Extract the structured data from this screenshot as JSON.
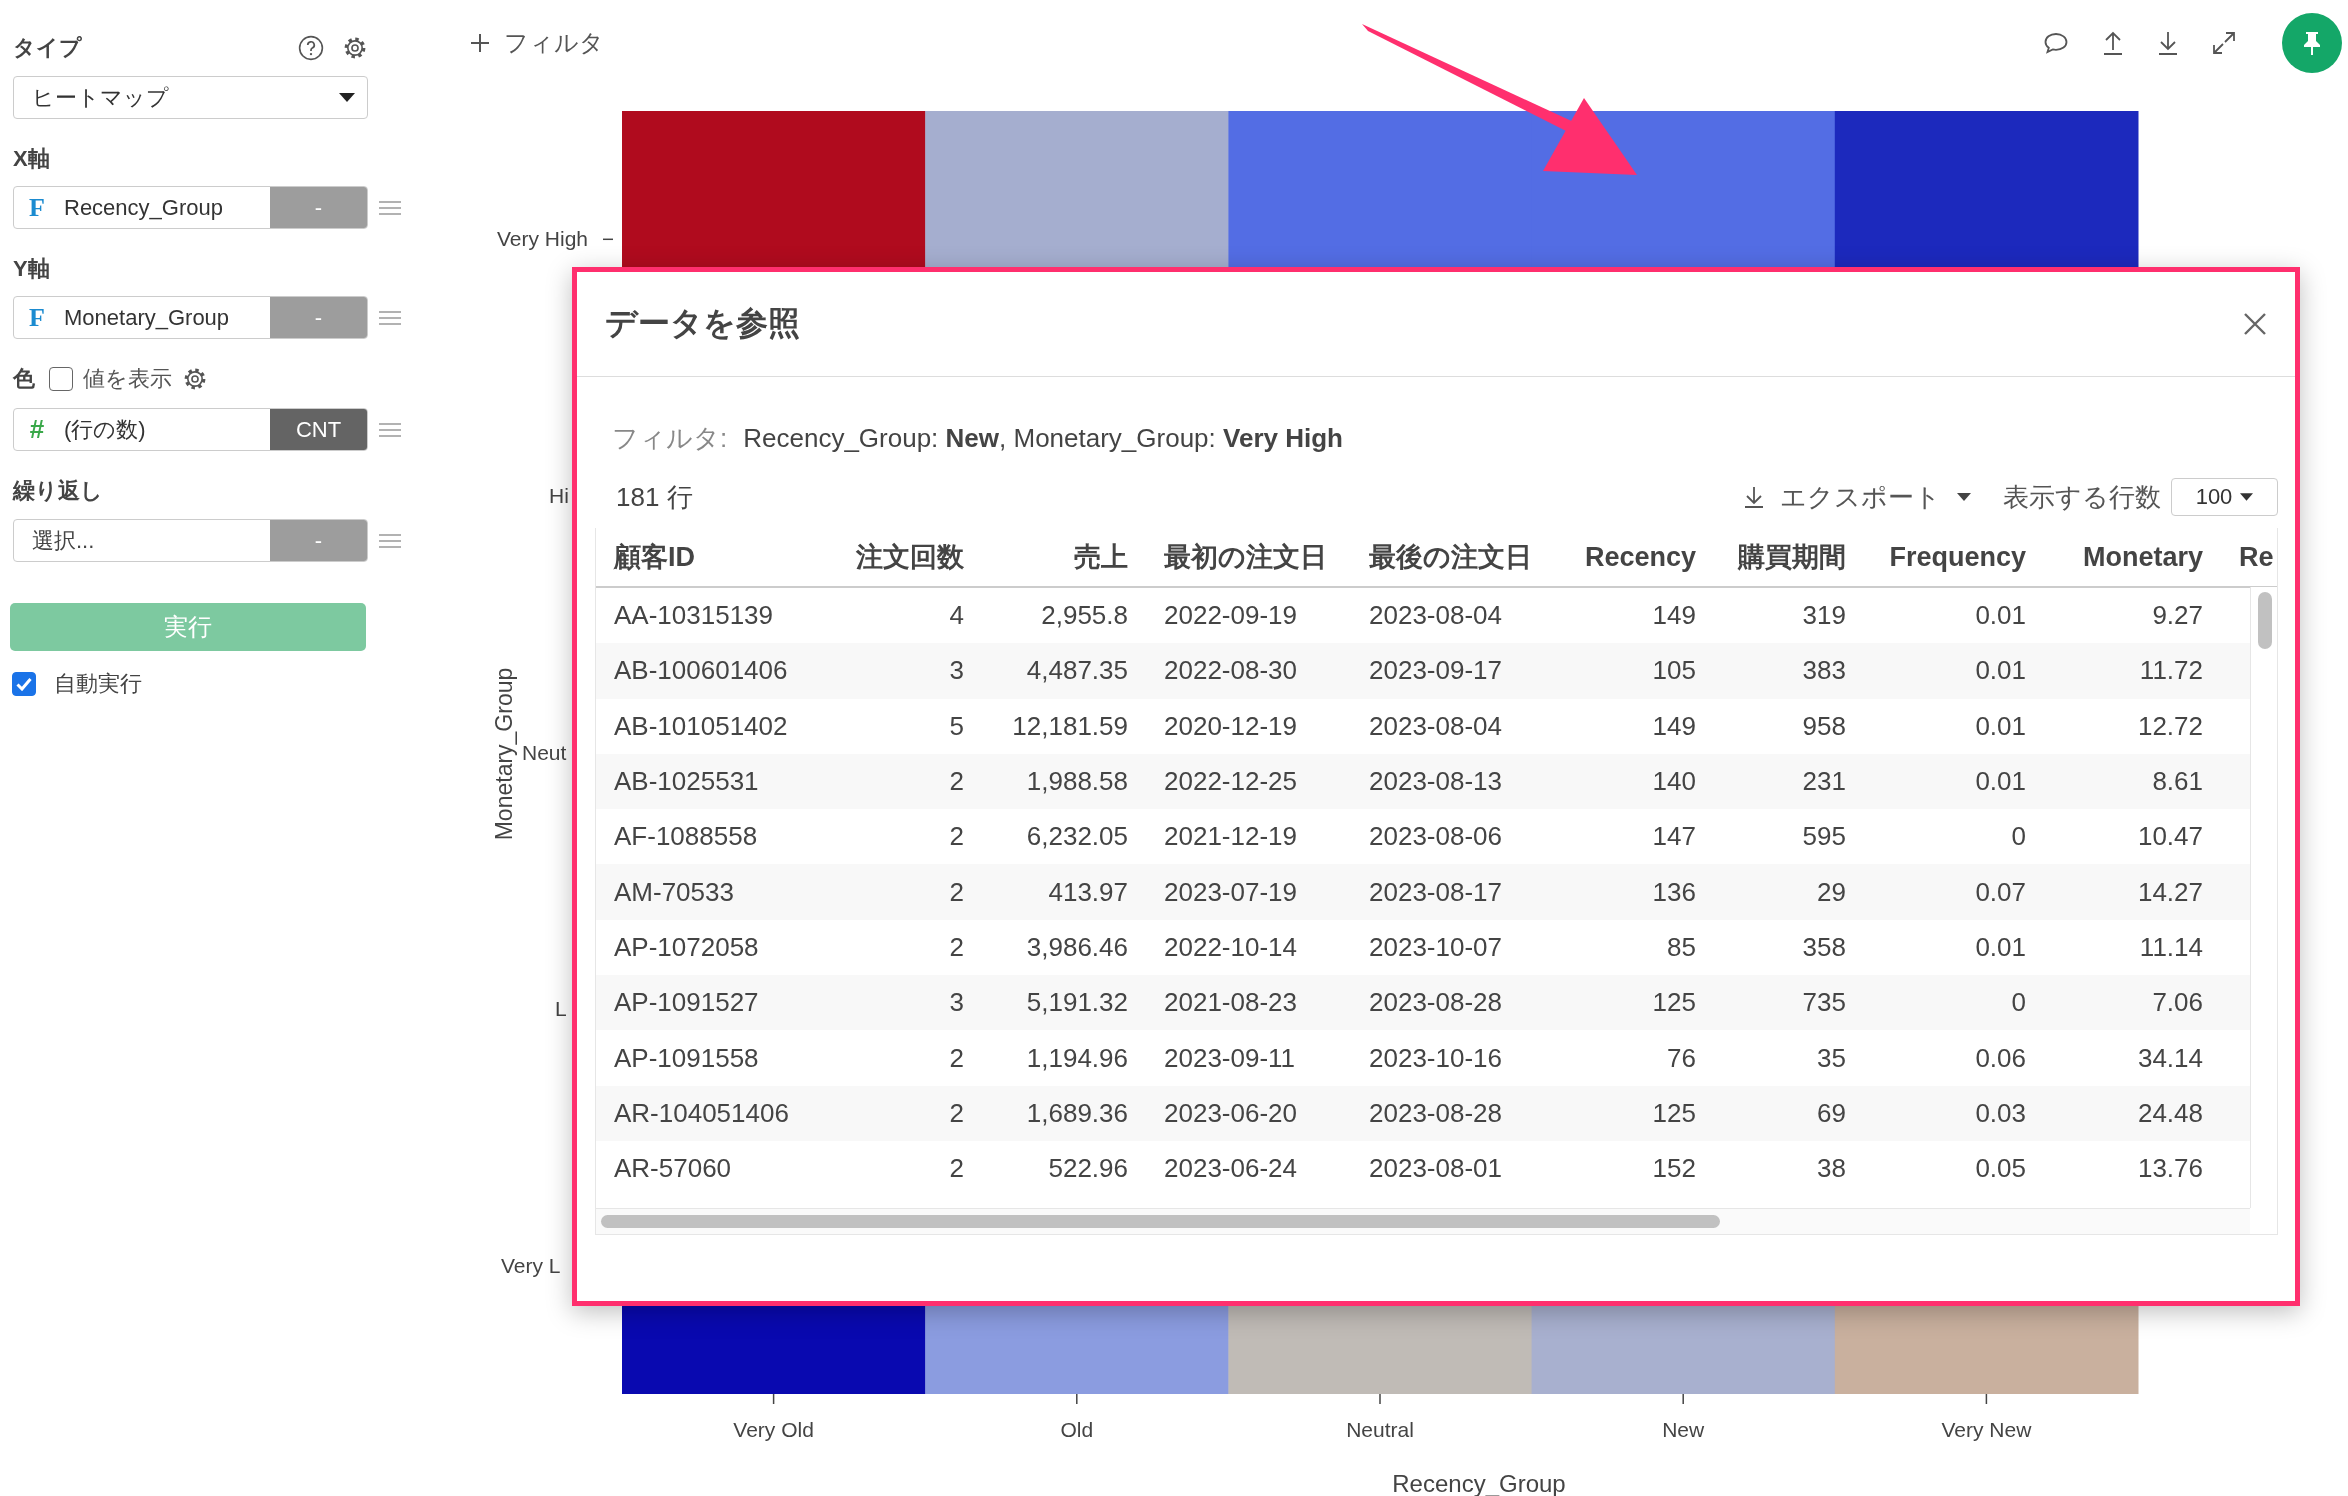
{
  "sidebar": {
    "type_label": "タイプ",
    "chart_type": "ヒートマップ",
    "x_axis": {
      "label": "X軸",
      "kind": "dimension",
      "field_icon": "F",
      "field": "Recency_Group",
      "aggregate": "-"
    },
    "y_axis": {
      "label": "Y軸",
      "kind": "dimension",
      "field_icon": "F",
      "field": "Monetary_Group",
      "aggregate": "-"
    },
    "color": {
      "label": "色",
      "show_values": {
        "label": "値を表示",
        "checked": false
      },
      "kind": "measure",
      "field_icon": "#",
      "field": "(行の数)",
      "aggregate": "CNT"
    },
    "repeat": {
      "label": "繰り返し",
      "placeholder": "選択...",
      "aggregate": "-"
    },
    "run_button": "実行",
    "auto_run": {
      "label": "自動実行",
      "checked": true
    }
  },
  "toolbar": {
    "filter_button": "フィルタ"
  },
  "chart": {
    "y_title": "Monetary_Group",
    "x_title": "Recency_Group",
    "y_labels": [
      "Very High",
      "Hi",
      "Neut",
      "L",
      "Very L"
    ],
    "x_labels": [
      "Very Old",
      "Old",
      "Neutral",
      "New",
      "Very New"
    ],
    "top_row_cells": [
      {
        "color": "#b00b1e"
      },
      {
        "color": "#a5aecf"
      },
      {
        "color": "#536de4"
      },
      {
        "color": "#536de4"
      },
      {
        "color": "#1c29bd"
      }
    ],
    "bottom_row_cells": [
      {
        "color": "#0909b0"
      },
      {
        "color": "#8b9ce0"
      },
      {
        "color": "#c0bbb6"
      },
      {
        "color": "#a8b0cf"
      },
      {
        "color": "#c9b09e"
      }
    ]
  },
  "dialog": {
    "title": "データを参照",
    "filter": {
      "label": "フィルタ:",
      "text": "Recency_Group: **New**, Monetary_Group: **Very High**"
    },
    "row_count": "181 行",
    "export_button": "エクスポート",
    "rows_label": "表示する行数",
    "rows_per_page": "100",
    "columns": [
      {
        "label": "顧客ID",
        "kind": "text"
      },
      {
        "label": "注文回数",
        "kind": "number"
      },
      {
        "label": "売上",
        "kind": "number"
      },
      {
        "label": "最初の注文日",
        "kind": "text"
      },
      {
        "label": "最後の注文日",
        "kind": "text"
      },
      {
        "label": "Recency",
        "kind": "number"
      },
      {
        "label": "購買期間",
        "kind": "number"
      },
      {
        "label": "Frequency",
        "kind": "number"
      },
      {
        "label": "Monetary",
        "kind": "number"
      },
      {
        "label": "Re",
        "kind": "text"
      }
    ],
    "rows": [
      [
        "AA-10315139",
        "4",
        "2,955.8",
        "2022-09-19",
        "2023-08-04",
        "149",
        "319",
        "0.01",
        "9.27"
      ],
      [
        "AB-100601406",
        "3",
        "4,487.35",
        "2022-08-30",
        "2023-09-17",
        "105",
        "383",
        "0.01",
        "11.72"
      ],
      [
        "AB-101051402",
        "5",
        "12,181.59",
        "2020-12-19",
        "2023-08-04",
        "149",
        "958",
        "0.01",
        "12.72"
      ],
      [
        "AB-1025531",
        "2",
        "1,988.58",
        "2022-12-25",
        "2023-08-13",
        "140",
        "231",
        "0.01",
        "8.61"
      ],
      [
        "AF-1088558",
        "2",
        "6,232.05",
        "2021-12-19",
        "2023-08-06",
        "147",
        "595",
        "0",
        "10.47"
      ],
      [
        "AM-70533",
        "2",
        "413.97",
        "2023-07-19",
        "2023-08-17",
        "136",
        "29",
        "0.07",
        "14.27"
      ],
      [
        "AP-1072058",
        "2",
        "3,986.46",
        "2022-10-14",
        "2023-10-07",
        "85",
        "358",
        "0.01",
        "11.14"
      ],
      [
        "AP-1091527",
        "3",
        "5,191.32",
        "2021-08-23",
        "2023-08-28",
        "125",
        "735",
        "0",
        "7.06"
      ],
      [
        "AP-1091558",
        "2",
        "1,194.96",
        "2023-09-11",
        "2023-10-16",
        "76",
        "35",
        "0.06",
        "34.14"
      ],
      [
        "AR-104051406",
        "2",
        "1,689.36",
        "2023-06-20",
        "2023-08-28",
        "125",
        "69",
        "0.03",
        "24.48"
      ],
      [
        "AR-57060",
        "2",
        "522.96",
        "2023-06-24",
        "2023-08-01",
        "152",
        "38",
        "0.05",
        "13.76"
      ]
    ]
  }
}
